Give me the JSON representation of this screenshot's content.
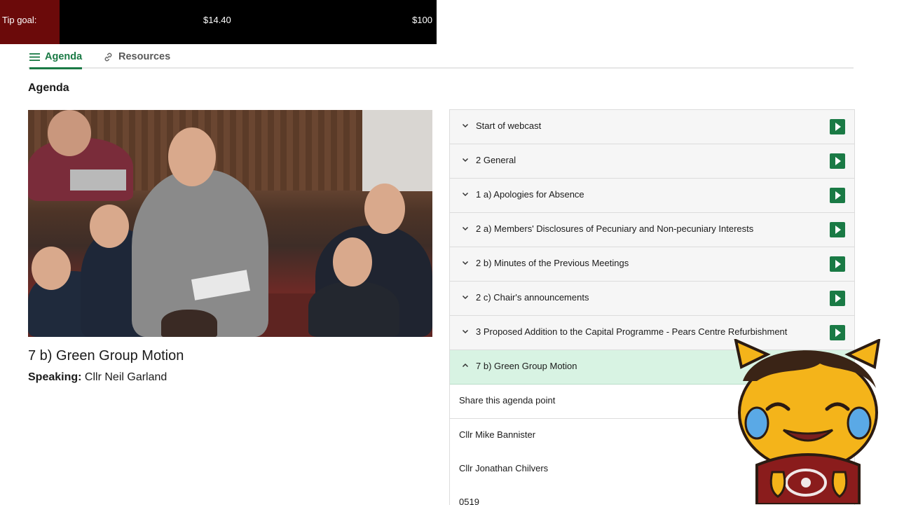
{
  "tip_overlay": {
    "label": "Tip goal:",
    "current": "$14.40",
    "goal": "$100",
    "progress": 0.144
  },
  "tabs": [
    {
      "label": "Agenda",
      "icon": "menu-lines-icon",
      "active": true
    },
    {
      "label": "Resources",
      "icon": "link-icon",
      "active": false
    }
  ],
  "page": {
    "heading": "Agenda"
  },
  "now_playing": {
    "title": "7 b) Green Group Motion",
    "speaking_label": "Speaking:",
    "speaker": "Cllr Neil Garland"
  },
  "agenda": {
    "items": [
      {
        "label": "Start of webcast"
      },
      {
        "label": "2 General"
      },
      {
        "label": "1 a) Apologies for Absence"
      },
      {
        "label": "2 a) Members' Disclosures of Pecuniary and Non-pecuniary Interests"
      },
      {
        "label": "2 b) Minutes of the Previous Meetings"
      },
      {
        "label": "2 c) Chair's announcements"
      },
      {
        "label": "3 Proposed Addition to the Capital Programme - Pears Centre Refurbishment"
      }
    ],
    "active_item": {
      "label": "7 b) Green Group Motion",
      "share_label": "Share this agenda point",
      "speakers": [
        "Cllr Mike Bannister",
        "Cllr Jonathan Chilvers",
        "0519"
      ]
    }
  },
  "colors": {
    "accent": "#1a7a45",
    "active_row": "#d8f3e3",
    "tip_fill": "#6b0a0a"
  }
}
